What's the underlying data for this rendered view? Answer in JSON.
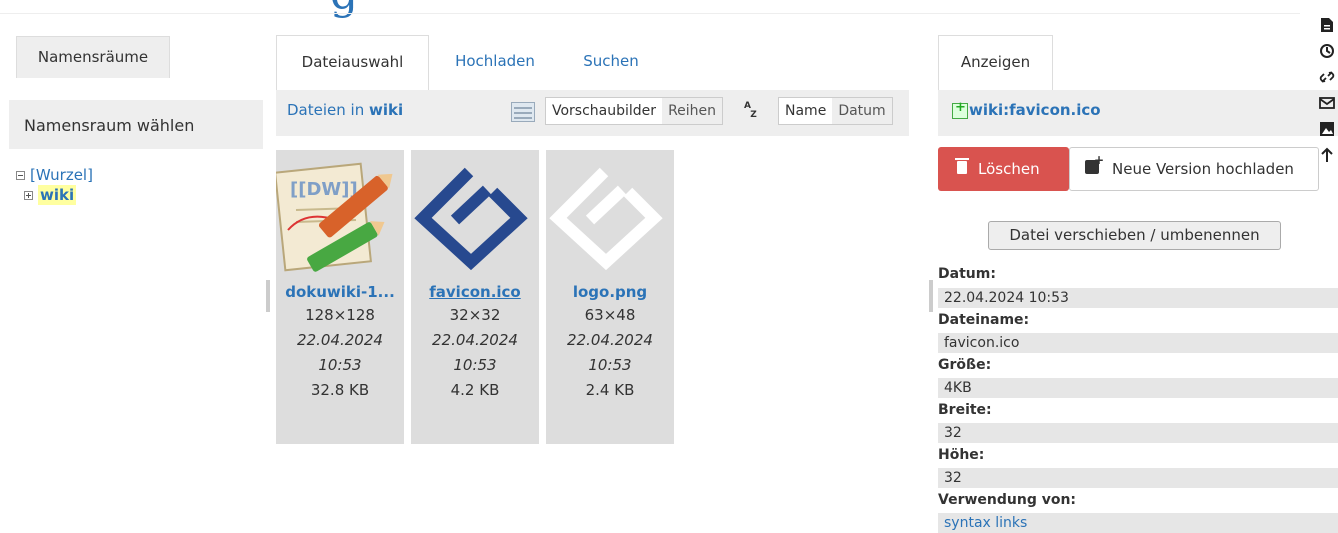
{
  "header": {
    "title_fragment": "g"
  },
  "namespaces": {
    "tab_label": "Namensräume",
    "choose_label": "Namensraum wählen",
    "tree": [
      {
        "label": "[Wurzel]",
        "expanded": true,
        "selected": false
      },
      {
        "label": "wiki",
        "expanded": false,
        "selected": true
      }
    ]
  },
  "media_manager": {
    "tabs": [
      {
        "label": "Dateiauswahl",
        "active": true
      },
      {
        "label": "Hochladen",
        "active": false
      },
      {
        "label": "Suchen",
        "active": false
      }
    ],
    "files_in_prefix": "Dateien in",
    "files_in_ns": "wiki",
    "view_options": [
      "Vorschaubilder",
      "Reihen"
    ],
    "sort_options": [
      "Name",
      "Datum"
    ],
    "files": [
      {
        "name": "dokuwiki-1...",
        "dimensions": "128×128",
        "date": "22.04.2024",
        "time": "10:53",
        "size": "32.8 KB",
        "underlined": false
      },
      {
        "name": "favicon.ico",
        "dimensions": "32×32",
        "date": "22.04.2024",
        "time": "10:53",
        "size": "4.2 KB",
        "underlined": true
      },
      {
        "name": "logo.png",
        "dimensions": "63×48",
        "date": "22.04.2024",
        "time": "10:53",
        "size": "2.4 KB",
        "underlined": false
      }
    ]
  },
  "detail": {
    "tab_label": "Anzeigen",
    "file_id": "wiki:favicon.ico",
    "delete_label": "Löschen",
    "new_version_label": "Neue Version hochladen",
    "move_label": "Datei verschieben / umbenennen",
    "fields": [
      {
        "key": "Datum:",
        "value": "22.04.2024 10:53"
      },
      {
        "key": "Dateiname:",
        "value": "favicon.ico"
      },
      {
        "key": "Größe:",
        "value": "4KB"
      },
      {
        "key": "Breite:",
        "value": "32"
      },
      {
        "key": "Höhe:",
        "value": "32"
      },
      {
        "key": "Verwendung von:",
        "value": "syntax links"
      }
    ]
  },
  "page_tools": [
    "page-icon",
    "history-icon",
    "link-icon",
    "mail-icon",
    "media-icon",
    "arrow-up-icon"
  ],
  "colors": {
    "link": "#2b73b7",
    "delete": "#d9534f",
    "panel": "#eeeeee",
    "thumb_bg": "#dddddd",
    "highlight": "#ffffa0"
  }
}
